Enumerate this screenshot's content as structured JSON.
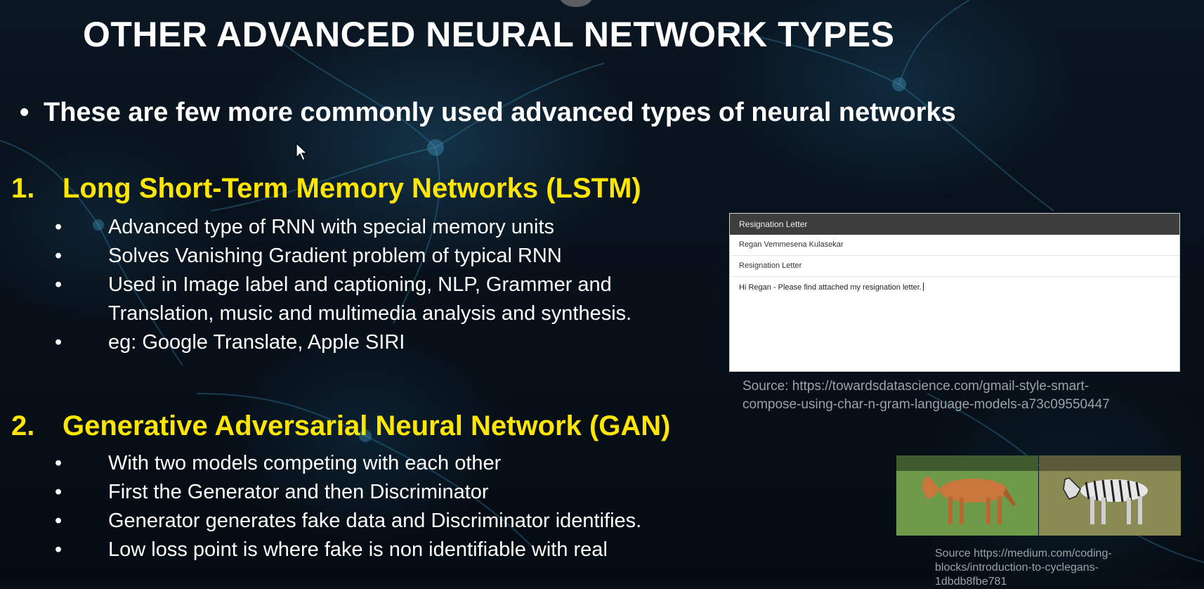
{
  "slide": {
    "title": "OTHER ADVANCED NEURAL NETWORK TYPES",
    "intro_bullet": "•",
    "intro": "These are few more commonly used advanced types of neural networks"
  },
  "sections": [
    {
      "number": "1.",
      "heading": "Long Short-Term Memory Networks (LSTM)",
      "bullets": [
        "Advanced type of RNN with special memory units",
        "Solves Vanishing Gradient problem of typical RNN",
        "Used in Image label and captioning, NLP, Grammer and Translation, music and multimedia analysis and synthesis.",
        "eg: Google Translate, Apple SIRI"
      ]
    },
    {
      "number": "2.",
      "heading": "Generative Adversarial Neural Network (GAN)",
      "bullets": [
        "With two models competing with each other",
        "First the Generator and then Discriminator",
        "Generator generates fake data and Discriminator identifies.",
        "Low loss point is where fake is non identifiable with real"
      ]
    }
  ],
  "bullet_glyph": "•",
  "email_example": {
    "header": "Resignation Letter",
    "to": "Regan Vemmesena Kulasekar",
    "subject": "Resignation Letter",
    "body": "Hi Regan - Please find attached my resignation letter."
  },
  "sources": {
    "lstm_line1": "Source: https://towardsdatascience.com/gmail-style-smart-",
    "lstm_line2": "compose-using-char-n-gram-language-models-a73c09550447",
    "gan_line1": "Source https://medium.com/coding-",
    "gan_line2": "blocks/introduction-to-cyclegans-",
    "gan_line3": "1dbdb8fbe781"
  },
  "colors": {
    "title": "#ffffff",
    "heading_accent": "#ffe600",
    "body_text": "#ffffff",
    "source_text": "#9aa3ab"
  },
  "icons": [
    "cursor-arrow-icon"
  ]
}
